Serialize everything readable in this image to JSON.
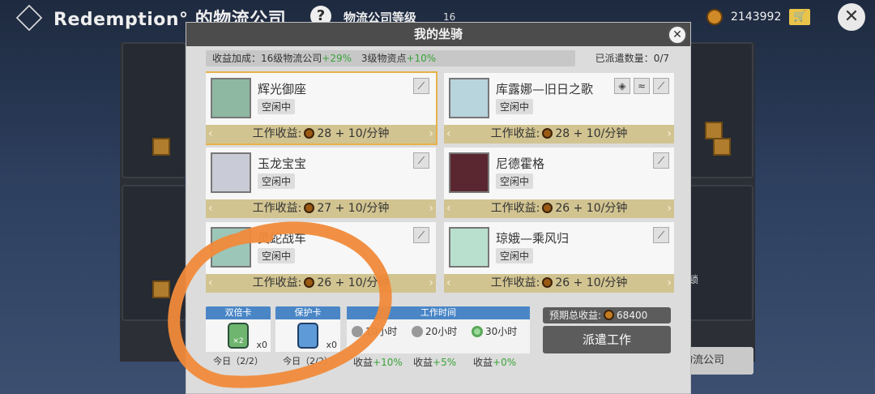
{
  "topbar": {
    "company_name": "Redemption° 的物流公司",
    "help_label": "?",
    "level_label": "物流公司等级",
    "level_value": "16",
    "coins": "2143992",
    "cart_icon": "cart-icon",
    "close_label": "✕"
  },
  "modal": {
    "title": "我的坐骑",
    "close_label": "✕",
    "bonus_label": "收益加成：16级物流公司",
    "bonus_company_pct": "+29%",
    "bonus_depot_label": "3级物资点",
    "bonus_depot_pct": "+10%",
    "dispatch_label": "已派遣数量：",
    "dispatch_value": "0/7"
  },
  "mounts": [
    {
      "name": "辉光御座",
      "status": "空闲中",
      "income_label": "工作收益:",
      "income_value": "28 + 10/分钟",
      "selected": true
    },
    {
      "name": "库露娜—旧日之歌",
      "status": "空闲中",
      "income_label": "工作收益:",
      "income_value": "28 + 10/分钟",
      "selected": false
    },
    {
      "name": "玉龙宝宝",
      "status": "空闲中",
      "income_label": "工作收益:",
      "income_value": "27 + 10/分钟",
      "selected": false
    },
    {
      "name": "尼德霍格",
      "status": "空闲中",
      "income_label": "工作收益:",
      "income_value": "26 + 10/分钟",
      "selected": false
    },
    {
      "name": "灵蛇战车",
      "status": "空闲中",
      "income_label": "工作收益:",
      "income_value": "26 + 10/分钟",
      "selected": false
    },
    {
      "name": "琼娥—乘风归",
      "status": "空闲中",
      "income_label": "工作收益:",
      "income_value": "26 + 10/分钟",
      "selected": false
    }
  ],
  "footer": {
    "double_card": {
      "title": "双倍卡",
      "count": "x0",
      "today": "今日（2/2）",
      "badge": "×2"
    },
    "protect_card": {
      "title": "保护卡",
      "count": "x0",
      "today": "今日（2/2）"
    },
    "worktime": {
      "title": "工作时间",
      "options": [
        {
          "label": "10小时",
          "bonus_label": "收益",
          "bonus": "+10%",
          "selected": false
        },
        {
          "label": "20小时",
          "bonus_label": "收益",
          "bonus": "+5%",
          "selected": false
        },
        {
          "label": "30小时",
          "bonus_label": "收益",
          "bonus": "+0%",
          "selected": true
        }
      ]
    },
    "expected_label": "预期总收益:",
    "expected_value": "68400",
    "dispatch_button": "派遣工作"
  },
  "background": {
    "button_label": "物流公司",
    "side_note": "锁"
  },
  "colors": {
    "accent_green": "#3aa33a",
    "card_title_blue": "#4a86c6",
    "income_band": "#d2c491",
    "selected_outline": "#e6b24a",
    "scribble_orange": "#f08a3a"
  }
}
